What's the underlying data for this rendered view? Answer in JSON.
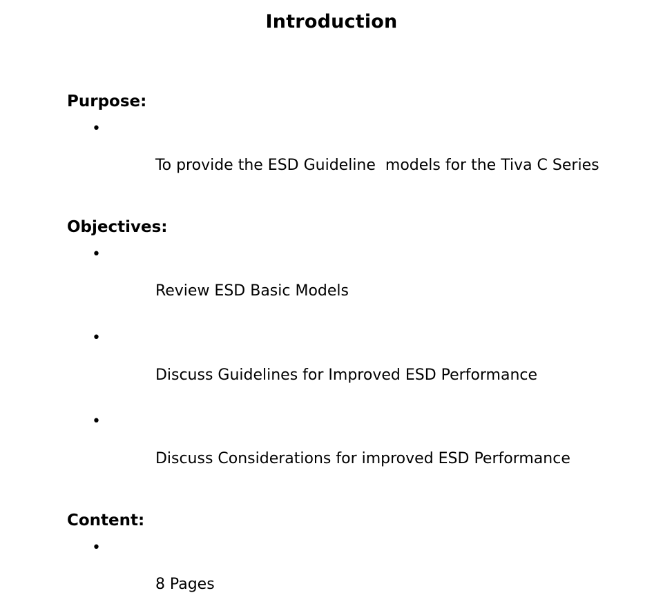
{
  "slide": {
    "title": "Introduction",
    "background_color": "#ffffff",
    "text_color": "#000000",
    "bullet_glyph": "•"
  },
  "sections": [
    {
      "heading": "Purpose:",
      "bullets": [
        "To provide the ESD Guideline  models for the Tiva C Series"
      ]
    },
    {
      "heading": "Objectives:",
      "bullets": [
        "Review ESD Basic Models",
        "Discuss Guidelines for Improved ESD Performance",
        "Discuss Considerations for improved ESD Performance"
      ]
    },
    {
      "heading": "Content:",
      "bullets": [
        "8 Pages"
      ]
    }
  ]
}
